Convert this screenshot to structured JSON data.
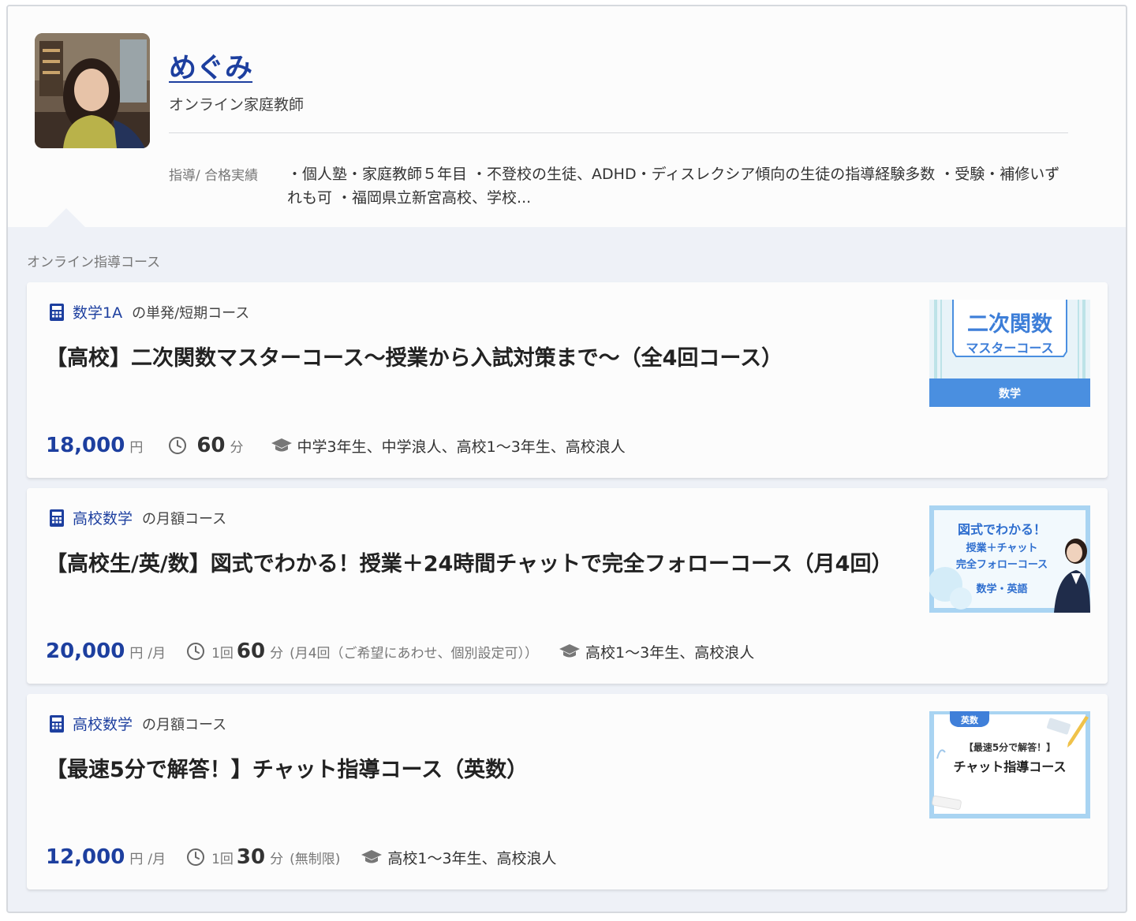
{
  "profile": {
    "name": "めぐみ",
    "title": "オンライン家庭教師",
    "achievements_label": "指導/ 合格実績",
    "achievements_text": "・個人塾・家庭教師５年目 ・不登校の生徒、ADHD・ディスレクシア傾向の生徒の指導経験多数 ・受験・補修いずれも可 ・福岡県立新宮高校、学校..."
  },
  "section_label": "オンライン指導コース",
  "courses": [
    {
      "subject": "数学1A",
      "kind": "の単発/短期コース",
      "title": "【高校】二次関数マスターコース〜授業から入試対策まで〜（全4回コース）",
      "price": "18,000",
      "price_unit": "円",
      "price_per": "",
      "minutes_prefix": "",
      "minutes": "60",
      "minutes_unit": "分",
      "minutes_note": "",
      "grades": "中学3年生、中学浪人、高校1〜3年生、高校浪人",
      "thumb": {
        "line1": "二次関数",
        "line2": "マスターコース",
        "band": "数学"
      }
    },
    {
      "subject": "高校数学",
      "kind": "の月額コース",
      "title": "【高校生/英/数】図式でわかる！授業＋24時間チャットで完全フォローコース（月4回）",
      "price": "20,000",
      "price_unit": "円",
      "price_per": "/月",
      "minutes_prefix": "1回",
      "minutes": "60",
      "minutes_unit": "分",
      "minutes_note": "(月4回（ご希望にあわせ、個別設定可））",
      "grades": "高校1〜3年生、高校浪人",
      "thumb": {
        "line1": "図式でわかる！",
        "line2": "授業＋チャット",
        "line3": "完全フォローコース",
        "line4": "数学・英語"
      }
    },
    {
      "subject": "高校数学",
      "kind": "の月額コース",
      "title": "【最速5分で解答！】チャット指導コース（英数）",
      "price": "12,000",
      "price_unit": "円",
      "price_per": "/月",
      "minutes_prefix": "1回",
      "minutes": "30",
      "minutes_unit": "分",
      "minutes_note": "(無制限)",
      "grades": "高校1〜3年生、高校浪人",
      "thumb": {
        "tag": "英数",
        "line1": "【最速5分で解答！】",
        "line2": "チャット指導コース"
      }
    }
  ],
  "colors": {
    "accent": "#1d3f9f",
    "thumb_blue": "#4a8fe0",
    "background": "#eef1f7"
  }
}
